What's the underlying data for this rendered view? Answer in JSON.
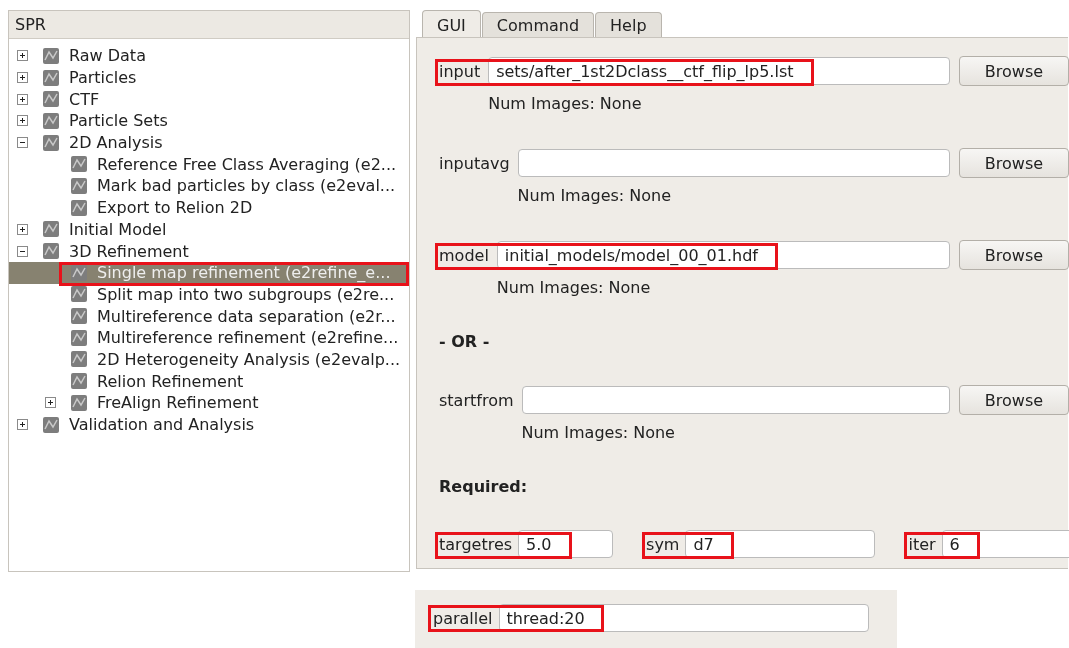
{
  "tree": {
    "header": "SPR",
    "items": [
      {
        "label": "Raw Data",
        "kind": "group",
        "expanded": false,
        "selected": false,
        "highlighted": false
      },
      {
        "label": "Particles",
        "kind": "group",
        "expanded": false,
        "selected": false,
        "highlighted": false
      },
      {
        "label": "CTF",
        "kind": "group",
        "expanded": false,
        "selected": false,
        "highlighted": false
      },
      {
        "label": "Particle Sets",
        "kind": "group",
        "expanded": false,
        "selected": false,
        "highlighted": false
      },
      {
        "label": "2D Analysis",
        "kind": "group",
        "expanded": true,
        "selected": false,
        "highlighted": false,
        "children": [
          {
            "label": "Reference Free Class Averaging (e2...",
            "kind": "leaf",
            "selected": false,
            "highlighted": false
          },
          {
            "label": "Mark bad particles by class (e2eval...",
            "kind": "leaf",
            "selected": false,
            "highlighted": false
          },
          {
            "label": "Export to Relion 2D",
            "kind": "leaf",
            "selected": false,
            "highlighted": false
          }
        ]
      },
      {
        "label": "Initial Model",
        "kind": "group",
        "expanded": false,
        "selected": false,
        "highlighted": false
      },
      {
        "label": "3D Refinement",
        "kind": "group",
        "expanded": true,
        "selected": false,
        "highlighted": false,
        "children": [
          {
            "label": "Single map refinement (e2refine_e...",
            "kind": "leaf",
            "selected": true,
            "highlighted": true
          },
          {
            "label": "Split map into two subgroups (e2re...",
            "kind": "leaf",
            "selected": false,
            "highlighted": false
          },
          {
            "label": "Multireference data separation (e2r...",
            "kind": "leaf",
            "selected": false,
            "highlighted": false
          },
          {
            "label": "Multireference refinement (e2refine...",
            "kind": "leaf",
            "selected": false,
            "highlighted": false
          },
          {
            "label": "2D Heterogeneity Analysis (e2evalp...",
            "kind": "leaf",
            "selected": false,
            "highlighted": false
          },
          {
            "label": "Relion Refinement",
            "kind": "leaf",
            "selected": false,
            "highlighted": false
          },
          {
            "label": "FreAlign Refinement",
            "kind": "group",
            "expanded": false,
            "selected": false,
            "highlighted": false
          }
        ]
      },
      {
        "label": "Validation and Analysis",
        "kind": "group",
        "expanded": false,
        "selected": false,
        "highlighted": false
      }
    ]
  },
  "tabs": [
    {
      "label": "GUI",
      "selected": true
    },
    {
      "label": "Command",
      "selected": false
    },
    {
      "label": "Help",
      "selected": false
    }
  ],
  "form": {
    "rows": [
      {
        "kind": "file",
        "label": "input",
        "value": "sets/after_1st2Dclass__ctf_flip_lp5.lst",
        "status": "Num Images: None",
        "button": "Browse",
        "highlighted": true
      },
      {
        "kind": "file",
        "label": "inputavg",
        "status": "Num Images: None",
        "button": "Browse",
        "highlighted": false
      },
      {
        "kind": "file",
        "label": "model",
        "value": "initial_models/model_00_01.hdf",
        "status": "Num Images: None",
        "button": "Browse",
        "highlighted": true
      },
      {
        "kind": "divider",
        "text": "- OR -"
      },
      {
        "kind": "file",
        "label": "startfrom",
        "status": "Num Images: None",
        "button": "Browse",
        "highlighted": false
      },
      {
        "kind": "heading",
        "text": "Required:"
      }
    ],
    "required_fields": [
      {
        "label": "targetres",
        "value": "5.0",
        "highlighted": true
      },
      {
        "label": "sym",
        "value": "d7",
        "highlighted": true
      },
      {
        "label": "iter",
        "value": "6",
        "highlighted": true
      }
    ]
  },
  "parallel": {
    "label": "parallel",
    "value": "thread:20",
    "highlighted": true
  }
}
